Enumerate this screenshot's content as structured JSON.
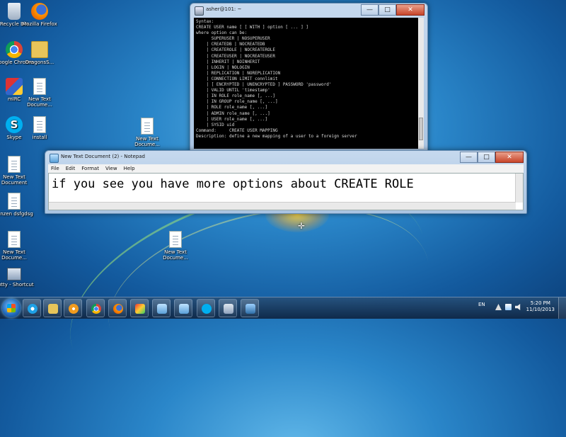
{
  "desktop_icons": [
    {
      "label": "Recycle Bin",
      "icon": "recycle-bin-icon"
    },
    {
      "label": "Mozilla Firefox",
      "icon": "firefox-icon"
    },
    {
      "label": "Google Chrome",
      "icon": "chrome-icon"
    },
    {
      "label": "DragonsS...",
      "icon": "folder-icon"
    },
    {
      "label": "mIRC",
      "icon": "mirc-icon"
    },
    {
      "label": "New Text Docume...",
      "icon": "text-document-icon"
    },
    {
      "label": "Skype",
      "icon": "skype-icon"
    },
    {
      "label": "install",
      "icon": "text-document-icon"
    },
    {
      "label": "New Text Docume...",
      "icon": "text-document-icon"
    },
    {
      "label": "New Text Document",
      "icon": "text-document-icon"
    },
    {
      "label": "tenzen dsfgdsg",
      "icon": "text-document-icon"
    },
    {
      "label": "New Text Docume...",
      "icon": "text-document-icon"
    },
    {
      "label": "New Text Docume...",
      "icon": "text-document-icon"
    },
    {
      "label": "putty - Shortcut",
      "icon": "putty-icon"
    }
  ],
  "terminal": {
    "title": "asher@101: ~",
    "lines": [
      "Syntax:",
      "CREATE USER name [ [ WITH ] option [ ... ] ]",
      "",
      "where option can be:",
      "",
      "      SUPERUSER | NOSUPERUSER",
      "    | CREATEDB | NOCREATEDB",
      "    | CREATEROLE | NOCREATEROLE",
      "    | CREATEUSER | NOCREATEUSER",
      "    | INHERIT | NOINHERIT",
      "    | LOGIN | NOLOGIN",
      "    | REPLICATION | NOREPLICATION",
      "    | CONNECTION LIMIT connlimit",
      "    | [ ENCRYPTED | UNENCRYPTED ] PASSWORD 'password'",
      "    | VALID UNTIL 'timestamp'",
      "    | IN ROLE role_name [, ...]",
      "    | IN GROUP role_name [, ...]",
      "    | ROLE role_name [, ...]",
      "    | ADMIN role_name [, ...]",
      "    | USER role_name [, ...]",
      "    | SYSID uid",
      "",
      "Command:     CREATE USER MAPPING",
      "Description: define a new mapping of a user to a foreign server"
    ]
  },
  "notepad": {
    "title": "New Text Document (2) - Notepad",
    "menu": [
      "File",
      "Edit",
      "Format",
      "View",
      "Help"
    ],
    "content": "if you see you have more options about CREATE ROLE"
  },
  "window_buttons": {
    "minimize": "—",
    "maximize": "□",
    "close": "✕"
  },
  "taskbar": {
    "apps": [
      "ie-icon",
      "explorer-icon",
      "media-player-icon",
      "chrome-icon",
      "firefox-icon",
      "paint-icon",
      "notepad-icon",
      "notepad-icon",
      "skype-icon",
      "putty-icon",
      "remote-desktop-icon"
    ],
    "language": "EN",
    "time": "5:20 PM",
    "date": "11/10/2013"
  },
  "colors": {
    "firefox": "#e66000",
    "chrome": "#db4437",
    "skype": "#00aff0",
    "folder": "#e8c55a"
  }
}
